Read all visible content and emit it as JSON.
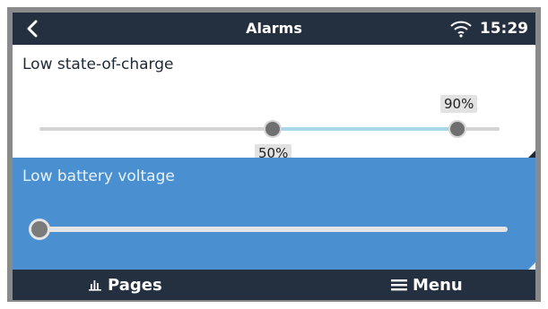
{
  "header": {
    "title": "Alarms",
    "time": "15:29",
    "back_icon": "chevron-left-icon",
    "wifi_icon": "wifi-icon"
  },
  "items": [
    {
      "label": "Low state-of-charge",
      "range_low_label": "50%",
      "range_high_label": "90%",
      "low_value_fraction": 0.5,
      "high_value_fraction": 0.9,
      "selected": false
    },
    {
      "label": "Low battery voltage",
      "slider_fraction": 0.0,
      "selected": true
    }
  ],
  "footer": {
    "pages_label": "Pages",
    "pages_icon": "bar-chart-icon",
    "menu_label": "Menu",
    "menu_icon": "hamburger-icon"
  },
  "colors": {
    "bar": "#243040",
    "selected": "#4a90d0",
    "range_fill": "#a8d8ea"
  }
}
